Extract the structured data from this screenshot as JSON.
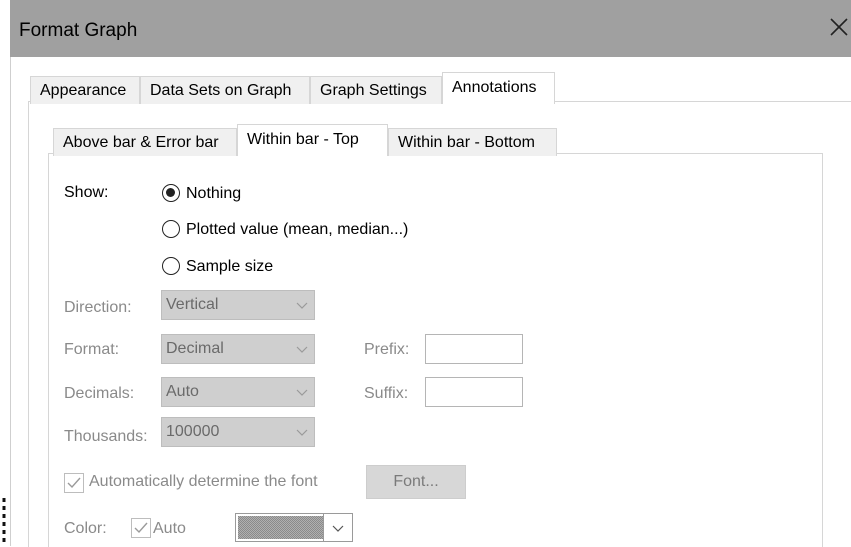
{
  "window": {
    "title": "Format Graph",
    "close_icon": "close-icon"
  },
  "tabs": [
    "Appearance",
    "Data Sets on Graph",
    "Graph Settings",
    "Annotations"
  ],
  "active_tab": "Annotations",
  "subtabs": [
    "Above bar & Error bar",
    "Within bar - Top",
    "Within bar - Bottom"
  ],
  "active_subtab": "Within bar - Top",
  "show": {
    "label": "Show:",
    "options": [
      "Nothing",
      "Plotted value (mean, median...)",
      "Sample size"
    ],
    "selected": "Nothing"
  },
  "direction": {
    "label": "Direction:",
    "value": "Vertical"
  },
  "format": {
    "label": "Format:",
    "value": "Decimal"
  },
  "decimals": {
    "label": "Decimals:",
    "value": "Auto"
  },
  "thousands": {
    "label": "Thousands:",
    "value": "100000"
  },
  "prefix": {
    "label": "Prefix:",
    "value": ""
  },
  "suffix": {
    "label": "Suffix:",
    "value": ""
  },
  "auto_font": {
    "label": "Automatically determine the font",
    "checked": true
  },
  "font_button": "Font...",
  "color": {
    "label": "Color:",
    "auto_label": "Auto",
    "auto_checked": true
  },
  "colors": {
    "titlebar": "#a0a0a0",
    "disabled_text": "#8a8a8a",
    "combo_bg": "#cfcfcf"
  }
}
